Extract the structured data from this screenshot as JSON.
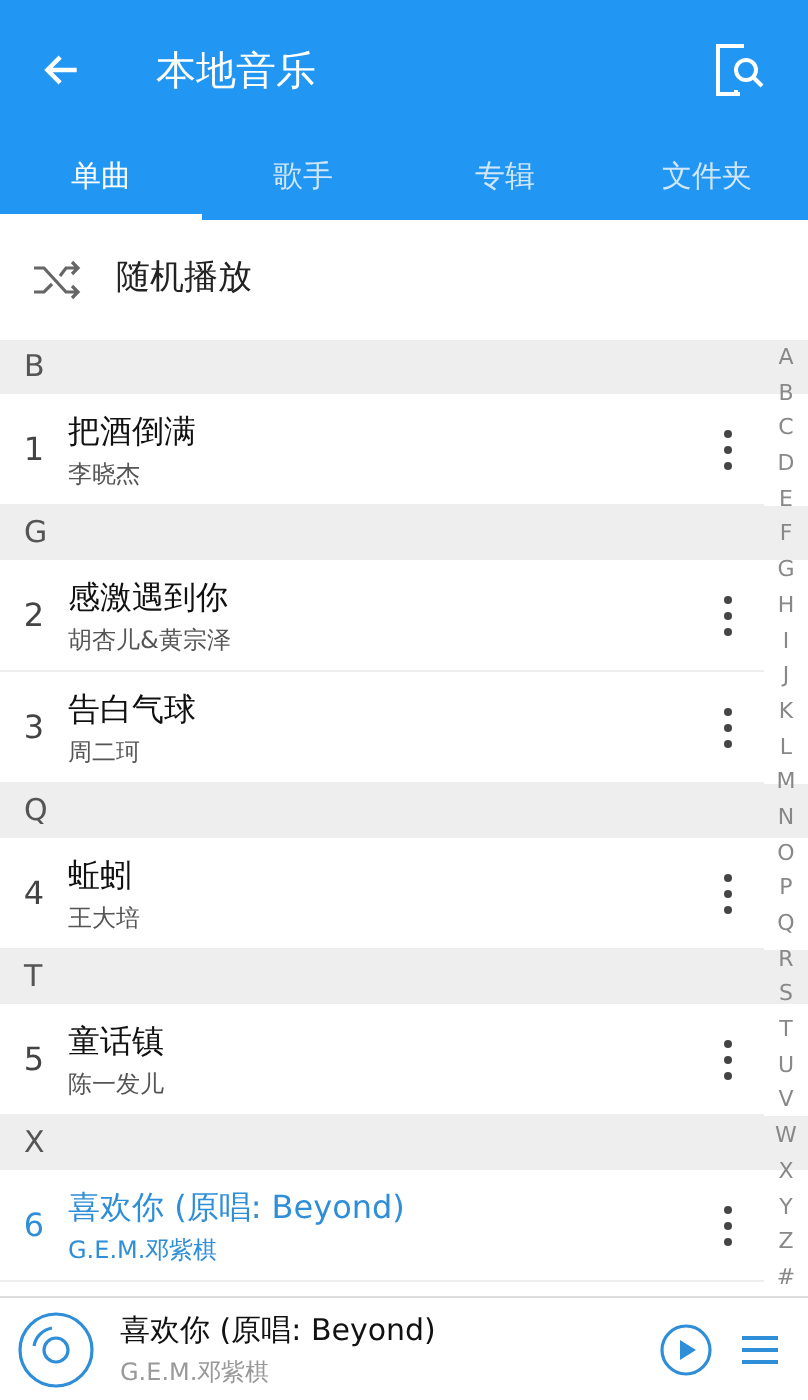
{
  "header": {
    "title": "本地音乐"
  },
  "tabs": [
    {
      "label": "单曲",
      "selected": true
    },
    {
      "label": "歌手",
      "selected": false
    },
    {
      "label": "专辑",
      "selected": false
    },
    {
      "label": "文件夹",
      "selected": false
    }
  ],
  "shuffle": {
    "label": "随机播放"
  },
  "sections": [
    {
      "letter": "B",
      "songs": [
        {
          "index": "1",
          "title": "把酒倒满",
          "artist": "李晓杰",
          "playing": false
        }
      ]
    },
    {
      "letter": "G",
      "songs": [
        {
          "index": "2",
          "title": "感激遇到你",
          "artist": "胡杏儿&黄宗泽",
          "playing": false
        },
        {
          "index": "3",
          "title": "告白气球",
          "artist": "周二珂",
          "playing": false
        }
      ]
    },
    {
      "letter": "Q",
      "songs": [
        {
          "index": "4",
          "title": "蚯蚓",
          "artist": "王大培",
          "playing": false
        }
      ]
    },
    {
      "letter": "T",
      "songs": [
        {
          "index": "5",
          "title": "童话镇",
          "artist": "陈一发儿",
          "playing": false
        }
      ]
    },
    {
      "letter": "X",
      "songs": [
        {
          "index": "6",
          "title": "喜欢你 (原唱: Beyond)",
          "artist": "G.E.M.邓紫棋",
          "playing": true
        }
      ]
    }
  ],
  "index_bar": [
    "A",
    "B",
    "C",
    "D",
    "E",
    "F",
    "G",
    "H",
    "I",
    "J",
    "K",
    "L",
    "M",
    "N",
    "O",
    "P",
    "Q",
    "R",
    "S",
    "T",
    "U",
    "V",
    "W",
    "X",
    "Y",
    "Z",
    "#"
  ],
  "now_playing": {
    "title": "喜欢你 (原唱: Beyond)",
    "artist": "G.E.M.邓紫棋"
  }
}
